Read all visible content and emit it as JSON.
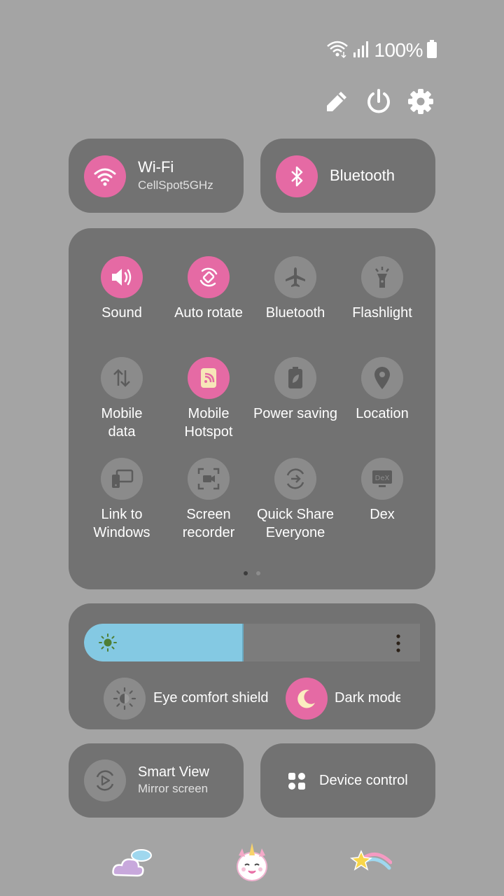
{
  "status": {
    "battery": "100%",
    "icons": [
      "wifi-icon",
      "signal-icon",
      "battery-icon"
    ]
  },
  "top_actions": [
    "edit-icon",
    "power-icon",
    "settings-icon"
  ],
  "wifi": {
    "label": "Wi-Fi",
    "network": "CellSpot5GHz"
  },
  "bluetooth_card": {
    "label": "Bluetooth"
  },
  "tiles": [
    {
      "label": "Sound",
      "icon": "volume-icon",
      "active": true
    },
    {
      "label": "Auto rotate",
      "icon": "rotate-icon",
      "active": true
    },
    {
      "label": "Bluetooth",
      "icon": "airplane-icon",
      "active": false
    },
    {
      "label": "Flashlight",
      "icon": "flashlight-icon",
      "active": false
    },
    {
      "label": "Mobile\ndata",
      "icon": "mobile-data-icon",
      "active": false
    },
    {
      "label": "Mobile\nHotspot",
      "icon": "hotspot-icon",
      "active": true
    },
    {
      "label": "Power saving",
      "icon": "power-saving-icon",
      "active": false
    },
    {
      "label": "Location",
      "icon": "location-icon",
      "active": false
    },
    {
      "label": "Link to\nWindows",
      "icon": "link-windows-icon",
      "active": false
    },
    {
      "label": "Screen\nrecorder",
      "icon": "screen-recorder-icon",
      "active": false
    },
    {
      "label": "Quick Share\nEveryone",
      "icon": "quick-share-icon",
      "active": false
    },
    {
      "label": "Dex",
      "icon": "dex-icon",
      "active": false
    }
  ],
  "pager": {
    "pages": 2,
    "current": 1
  },
  "brightness": {
    "level": 0.47
  },
  "eye_comfort": {
    "label": "Eye comfort shield"
  },
  "dark_mode": {
    "label": "Dark mode"
  },
  "smart_view": {
    "label": "Smart View",
    "sub": "Mirror screen"
  },
  "device_control": {
    "label": "Device control"
  },
  "stickers": [
    "cloud-sticker-icon",
    "unicorn-sticker-icon",
    "shooting-star-sticker-icon"
  ],
  "colors": {
    "accent": "#e56aa4",
    "card": "#727272",
    "background": "#a4a4a4",
    "brightness_fill": "#84c9e3"
  }
}
